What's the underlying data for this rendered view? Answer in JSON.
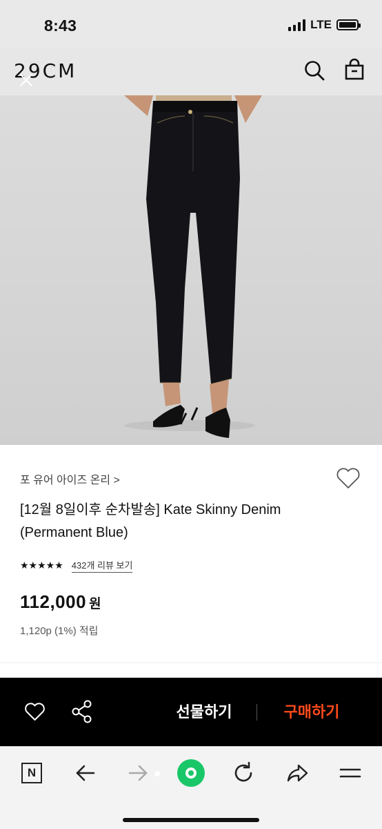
{
  "status_bar": {
    "time": "8:43",
    "network": "LTE",
    "battery_level": 1.0
  },
  "header": {
    "logo": "29CM",
    "icons": [
      "close-icon",
      "search-icon",
      "shopping-bag-icon"
    ]
  },
  "product": {
    "brand": "포 유어 아이즈 온리 >",
    "title": "[12월 8일이후 순차발송] Kate Skinny Denim (Permanent Blue)",
    "rating_value": 4.5,
    "stars": "★★★★★",
    "review_link": "432개 리뷰 보기",
    "price": "112,000",
    "price_unit": "원",
    "points": "1,120p (1%) 적립"
  },
  "purchase_bar": {
    "gift_label": "선물하기",
    "buy_label": "구매하기",
    "buy_color": "#ff4a1c",
    "icons": [
      "heart-icon",
      "share-icon"
    ]
  },
  "browser_toolbar": {
    "n_label": "N",
    "icons": [
      "naver-icon",
      "back-arrow-icon",
      "forward-arrow-icon",
      "green-circle-icon",
      "reload-icon",
      "share-arrow-icon",
      "menu-icon"
    ],
    "accent": "#19c768"
  }
}
